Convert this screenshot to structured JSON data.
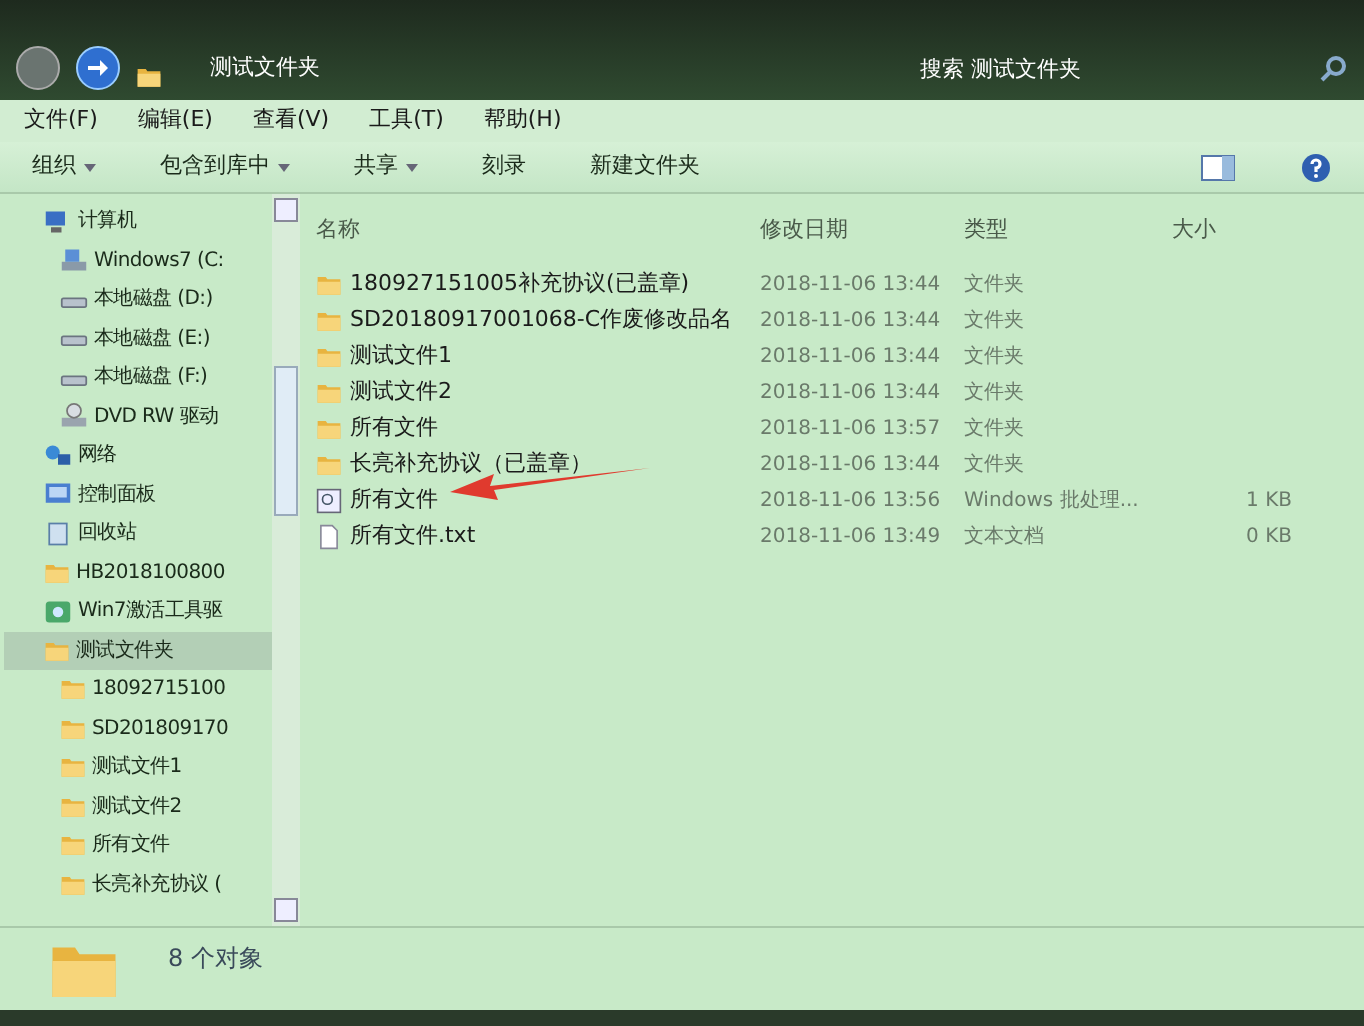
{
  "address_bar": {
    "path": "测试文件夹",
    "search_placeholder": "搜索 测试文件夹"
  },
  "menu": [
    "文件(F)",
    "编辑(E)",
    "查看(V)",
    "工具(T)",
    "帮助(H)"
  ],
  "toolbar": [
    {
      "label": "组织",
      "dropdown": true
    },
    {
      "label": "包含到库中",
      "dropdown": true
    },
    {
      "label": "共享",
      "dropdown": true
    },
    {
      "label": "刻录",
      "dropdown": false
    },
    {
      "label": "新建文件夹",
      "dropdown": false
    }
  ],
  "sidebar": [
    {
      "label": "计算机",
      "kind": "computer",
      "selected": false,
      "children": [
        {
          "label": "Windows7 (C:",
          "kind": "system-drive",
          "selected": false
        },
        {
          "label": "本地磁盘 (D:)",
          "kind": "drive",
          "selected": false
        },
        {
          "label": "本地磁盘 (E:)",
          "kind": "drive",
          "selected": false
        },
        {
          "label": "本地磁盘 (F:)",
          "kind": "drive",
          "selected": false
        },
        {
          "label": "DVD RW 驱动",
          "kind": "dvd",
          "selected": false
        }
      ]
    },
    {
      "label": "网络",
      "kind": "network",
      "selected": false
    },
    {
      "label": "控制面板",
      "kind": "control-panel",
      "selected": false
    },
    {
      "label": "回收站",
      "kind": "recycle-bin",
      "selected": false
    },
    {
      "label": "HB201810080​0",
      "kind": "folder",
      "selected": false
    },
    {
      "label": "Win7激活工具驱",
      "kind": "app",
      "selected": false
    },
    {
      "label": "测试文件夹",
      "kind": "folder",
      "selected": true,
      "children": [
        {
          "label": "18092715100",
          "kind": "folder",
          "selected": false
        },
        {
          "label": "SD201809170",
          "kind": "folder",
          "selected": false
        },
        {
          "label": "测试文件1",
          "kind": "folder",
          "selected": false
        },
        {
          "label": "测试文件2",
          "kind": "folder",
          "selected": false
        },
        {
          "label": "所有文件",
          "kind": "folder",
          "selected": false
        },
        {
          "label": "长亮补充协议 (",
          "kind": "folder",
          "selected": false
        }
      ]
    }
  ],
  "columns": [
    "名称",
    "修改日期",
    "类型",
    "大小"
  ],
  "files": [
    {
      "name": "180927151005补充协议(已盖章)",
      "date": "2018-11-06 13:44",
      "type": "文件夹",
      "kind": "folder"
    },
    {
      "name": "SD20180917001068-C作废修改品名",
      "date": "2018-11-06 13:44",
      "type": "文件夹",
      "kind": "folder"
    },
    {
      "name": "测试文件1",
      "date": "2018-11-06 13:44",
      "type": "文件夹",
      "kind": "folder"
    },
    {
      "name": "测试文件2",
      "date": "2018-11-06 13:44",
      "type": "文件夹",
      "kind": "folder"
    },
    {
      "name": "所有文件",
      "date": "2018-11-06 13:57",
      "type": "文件夹",
      "kind": "folder"
    },
    {
      "name": "长亮补充协议（已盖章）",
      "date": "2018-11-06 13:44",
      "type": "文件夹",
      "kind": "folder"
    },
    {
      "name": "所有文件",
      "date": "2018-11-06 13:56",
      "type": "Windows 批处理...",
      "size": "1 KB",
      "kind": "batch"
    },
    {
      "name": "所有文件.txt",
      "date": "2018-11-06 13:49",
      "type": "文本文档",
      "size": "0 KB",
      "kind": "text"
    }
  ],
  "status_bar": {
    "count": "8 个对象"
  }
}
